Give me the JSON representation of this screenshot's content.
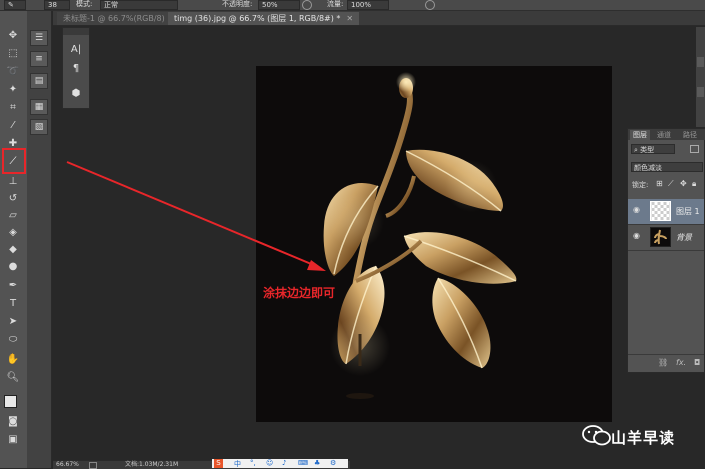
{
  "options_bar": {
    "size_value": "38",
    "mode_label": "模式:",
    "mode_value": "正常",
    "opacity_label": "不透明度:",
    "opacity_value": "50%",
    "flow_label": "流量:",
    "flow_value": "100%"
  },
  "tabs": [
    {
      "label": "未标题-1 @ 66.7%(RGB/8)",
      "active": false
    },
    {
      "label": "timg (36).jpg @ 66.7% (图层 1, RGB/8#) *",
      "active": true
    }
  ],
  "char_panel": {
    "a_glyph": "A|",
    "pilcrow_glyph": "¶"
  },
  "layers_panel": {
    "tabs": [
      "图层",
      "通道",
      "路径"
    ],
    "filter_value": "类型",
    "blend_mode": "颜色减淡",
    "lock_label": "锁定:",
    "layers": [
      {
        "name": "图层 1",
        "selected": true
      },
      {
        "name": "背景",
        "selected": false
      }
    ],
    "footer_fx": "fx."
  },
  "status_bar": {
    "zoom": "66.67%",
    "doc_info": "文档:1.03M/2.31M"
  },
  "annotation": {
    "text": "涂抹边边即可",
    "color": "#e8262a"
  },
  "watermark": {
    "text": "山羊早读"
  },
  "colors": {
    "accent": "#e8262a",
    "workspace": "#282828",
    "panel": "#535353"
  }
}
